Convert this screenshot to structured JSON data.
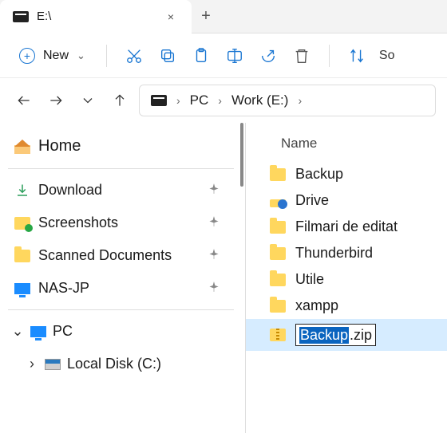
{
  "tab": {
    "title": "E:\\",
    "close": "×",
    "new": "+"
  },
  "toolbar": {
    "new_label": "New",
    "sort_label": "So"
  },
  "breadcrumb": {
    "seg1": "PC",
    "seg2": "Work (E:)"
  },
  "sidebar": {
    "home": "Home",
    "items": [
      {
        "label": "Download"
      },
      {
        "label": "Screenshots"
      },
      {
        "label": "Scanned Documents"
      },
      {
        "label": "NAS-JP"
      }
    ],
    "pc": "PC",
    "local_disk": "Local Disk (C:)"
  },
  "content": {
    "header_name": "Name",
    "rows": [
      {
        "label": "Backup",
        "type": "folder"
      },
      {
        "label": "Drive",
        "type": "cloud"
      },
      {
        "label": "Filmari de editat",
        "type": "folder"
      },
      {
        "label": "Thunderbird",
        "type": "folder"
      },
      {
        "label": "Utile",
        "type": "folder"
      },
      {
        "label": "xampp",
        "type": "folder"
      }
    ],
    "rename": {
      "selected": "Backup",
      "rest": ".zip"
    }
  }
}
